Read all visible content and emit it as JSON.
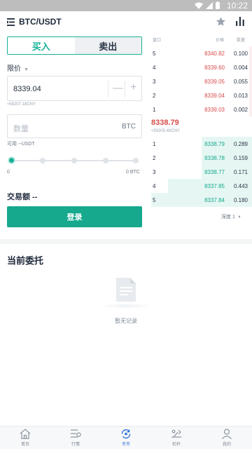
{
  "status_bar": {
    "time": "10:22"
  },
  "header": {
    "pair": "BTC/USDT"
  },
  "trade": {
    "tabs": {
      "buy": "买入",
      "sell": "卖出"
    },
    "order_type": "限价",
    "price_value": "8339.04",
    "price_cny": "≈59207.18CNY",
    "qty_placeholder": "数量",
    "qty_unit": "BTC",
    "available": "可用 --USDT",
    "slider_min": "0",
    "slider_max": "0 BTC",
    "slider_percent": 0,
    "amount": "交易额 --",
    "login": "登录"
  },
  "orderbook": {
    "headers": {
      "level": "盘口",
      "price": "价格",
      "qty": "数量"
    },
    "asks": [
      {
        "idx": "5",
        "price": "8340.82",
        "qty": "0.100"
      },
      {
        "idx": "4",
        "price": "8339.60",
        "qty": "0.004"
      },
      {
        "idx": "3",
        "price": "8339.05",
        "qty": "0.055"
      },
      {
        "idx": "2",
        "price": "8339.04",
        "qty": "0.013"
      },
      {
        "idx": "1",
        "price": "8339.03",
        "qty": "0.002"
      }
    ],
    "last_price": "8338.79",
    "last_cny": "≈59205.40CNY",
    "bids": [
      {
        "idx": "1",
        "price": "8338.79",
        "qty": "0.289"
      },
      {
        "idx": "2",
        "price": "8338.78",
        "qty": "0.159"
      },
      {
        "idx": "3",
        "price": "8338.77",
        "qty": "0.171"
      },
      {
        "idx": "4",
        "price": "8337.85",
        "qty": "0.443"
      },
      {
        "idx": "5",
        "price": "8337.84",
        "qty": "0.180"
      }
    ],
    "depth": "深度 1"
  },
  "orders": {
    "title": "当前委托",
    "empty": "暂无记录"
  },
  "nav": [
    {
      "label": "首页",
      "icon": "home-icon"
    },
    {
      "label": "行情",
      "icon": "market-icon"
    },
    {
      "label": "币币",
      "icon": "exchange-icon"
    },
    {
      "label": "杠杆",
      "icon": "leverage-icon"
    },
    {
      "label": "我的",
      "icon": "profile-icon"
    }
  ],
  "colors": {
    "accent": "#16a98e",
    "ask": "#d84b4b",
    "nav_active": "#2a6fd6"
  }
}
